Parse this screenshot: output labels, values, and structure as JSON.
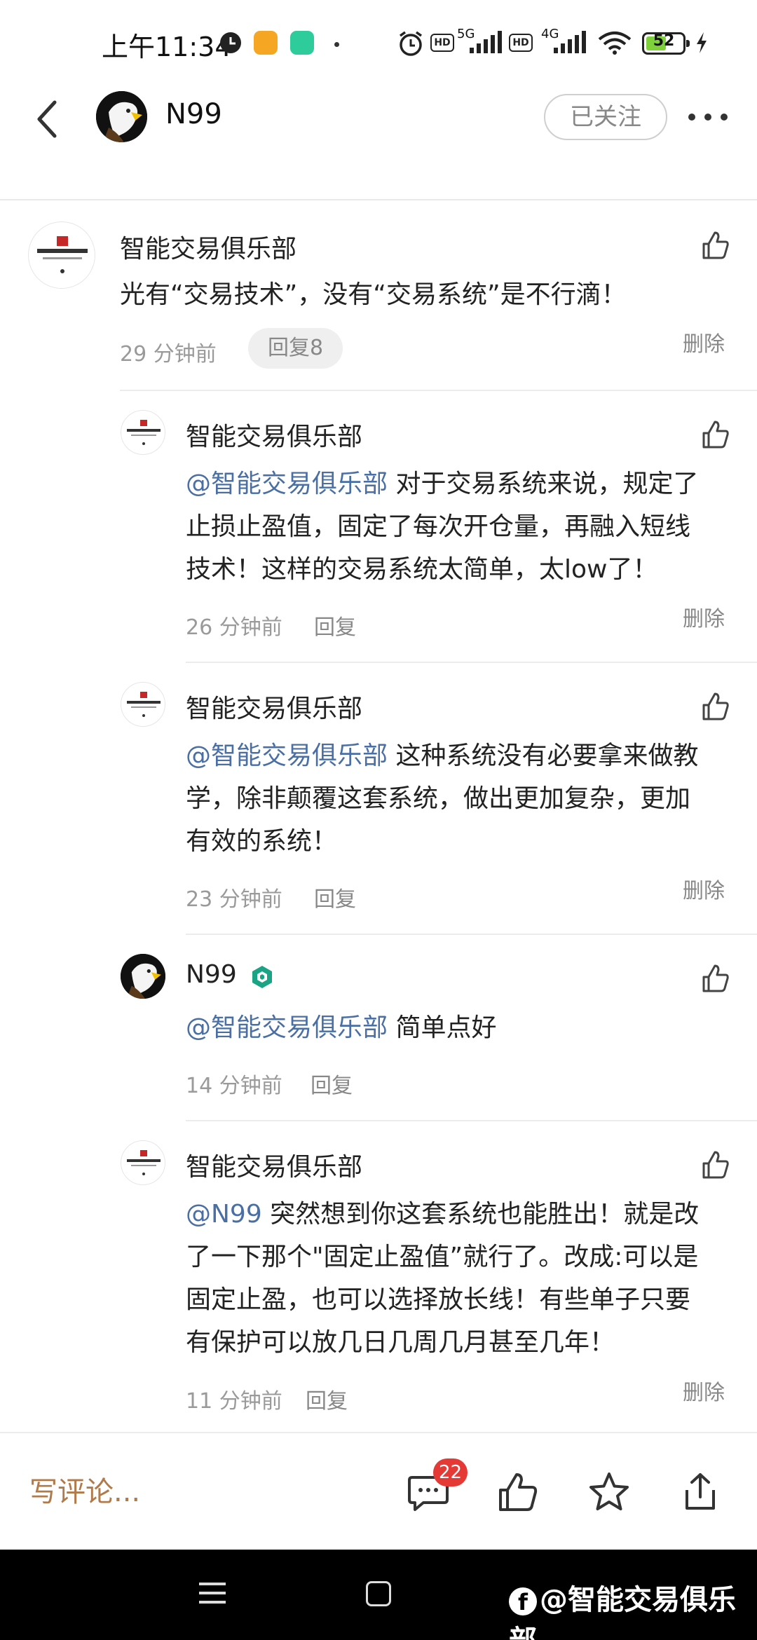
{
  "status_bar": {
    "time": "上午11:34",
    "network_1": "5G",
    "network_2": "4G",
    "hd_1": "HD",
    "hd_2": "HD",
    "battery": "52",
    "icons": [
      "clock-icon",
      "app-notification-icon",
      "app-notification-icon",
      "alarm-icon",
      "signal-icon",
      "wifi-icon",
      "battery-icon",
      "charging-icon"
    ]
  },
  "header": {
    "username": "N99",
    "follow_label": "已关注"
  },
  "comments": [
    {
      "name": "智能交易俱乐部",
      "text": "光有“交易技术”，没有“交易系统”是不行滴！",
      "time": "29 分钟前",
      "reply_label": "回复8",
      "delete_label": "删除"
    }
  ],
  "replies": [
    {
      "name": "智能交易俱乐部",
      "mention": "@智能交易俱乐部",
      "text_line1": " 对于交易系统来说，规定了",
      "text_line2": "止损止盈值，固定了每次开仓量，再融入短线",
      "text_line3": "技术！这样的交易系统太简单，太low了！",
      "time": "26 分钟前",
      "reply_label": "回复",
      "delete_label": "删除"
    },
    {
      "name": "智能交易俱乐部",
      "mention": "@智能交易俱乐部",
      "text_line1": " 这种系统没有必要拿来做教",
      "text_line2": "学，除非颠覆这套系统，做出更加复杂，更加",
      "text_line3": "有效的系统！",
      "time": "23 分钟前",
      "reply_label": "回复",
      "delete_label": "删除"
    },
    {
      "name": "N99",
      "mention": "@智能交易俱乐部",
      "text_line1": " 简单点好",
      "time": "14 分钟前",
      "reply_label": "回复"
    },
    {
      "name": "智能交易俱乐部",
      "mention": "@N99",
      "text_line1": " 突然想到你这套系统也能胜出！就是改",
      "text_line2": "了一下那个\"固定止盈值”就行了。改成:可以是",
      "text_line3": "固定止盈，也可以选择放长线！有些单子只要",
      "text_line4": "有保护可以放几日几周几月甚至几年！",
      "time": "11 分钟前",
      "reply_label": "回复",
      "delete_label": "删除"
    }
  ],
  "bottom_bar": {
    "write_placeholder": "写评论...",
    "comment_count": "22"
  },
  "watermark": {
    "text": "@智能交易俱乐部"
  },
  "colors": {
    "mention": "#4a6fa5",
    "write_comment": "#b07a4a",
    "badge": "#e53935"
  }
}
